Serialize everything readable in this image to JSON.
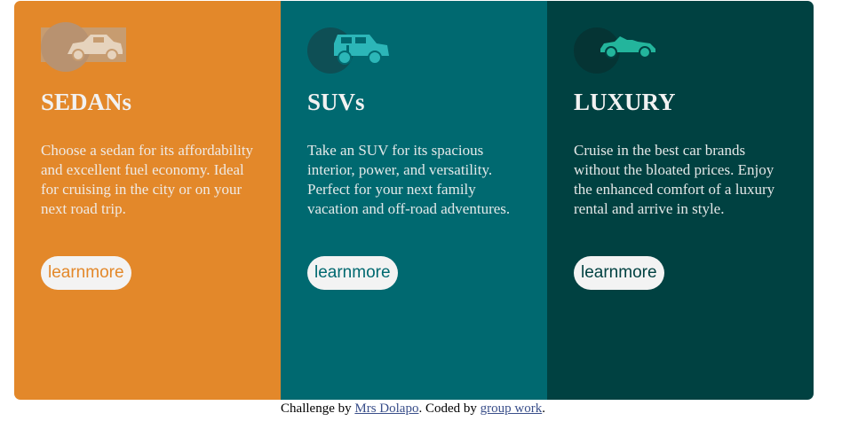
{
  "cards": [
    {
      "title": "SEDANs",
      "description": "Choose a sedan for its affordability and excellent fuel economy. Ideal for cruising in the city or on your next road trip.",
      "button_label": "learnmore",
      "icon": "sedan-car-icon",
      "color": "#e3882a"
    },
    {
      "title": "SUVs",
      "description": "Take an SUV for its spacious interior, power, and versatility. Perfect for your next family vacation and off-road adventures.",
      "button_label": "learnmore",
      "icon": "suv-car-icon",
      "color": "#006970"
    },
    {
      "title": "LUXURY",
      "description": "Cruise in the best car brands without the bloated prices. Enjoy the enhanced comfort of a luxury rental and arrive in style.",
      "button_label": "learnmore",
      "icon": "luxury-car-icon",
      "color": "#004141"
    }
  ],
  "footer": {
    "prefix": "Challenge by ",
    "author_link": "Mrs Dolapo",
    "middle": ". Coded by ",
    "coder_link": "group work",
    "suffix": "."
  },
  "colors": {
    "icon_sedan": "#e6d3bd",
    "icon_suv": "#2cb6b8",
    "icon_luxury": "#23b59c"
  }
}
